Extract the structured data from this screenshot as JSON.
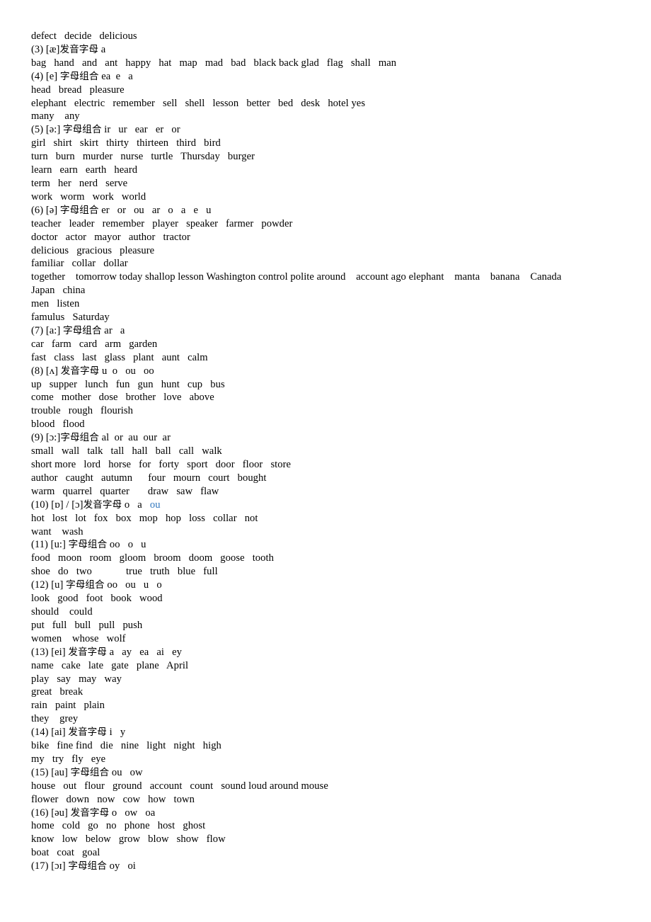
{
  "document": {
    "title": "English Phonetics Word List",
    "text_color": "#000000",
    "accent_color": "#3077BE",
    "background_color": "#ffffff"
  },
  "lines": [
    {
      "id": "l1",
      "type": "words",
      "text": "defect   decide   delicious"
    },
    {
      "id": "l2",
      "type": "heading",
      "number": "(3)",
      "ipa": "[æ]",
      "cjk": "发音字母",
      "letters": "a",
      "text": "(3) [æ]发音字母 a"
    },
    {
      "id": "l3",
      "type": "words",
      "text": "bag   hand   and   ant   happy   hat   map   mad   bad   black back glad   flag   shall   man"
    },
    {
      "id": "l4",
      "type": "heading",
      "number": "(4)",
      "ipa": "[e]",
      "cjk": "字母组合",
      "letters": "ea  e   a",
      "text": "(4) [e] 字母组合 ea  e   a"
    },
    {
      "id": "l5",
      "type": "words",
      "text": "head   bread   pleasure"
    },
    {
      "id": "l6",
      "type": "words",
      "text": "elephant   electric   remember   sell   shell   lesson   better   bed   desk   hotel yes"
    },
    {
      "id": "l7",
      "type": "words",
      "text": "many    any"
    },
    {
      "id": "l8",
      "type": "heading",
      "number": "(5)",
      "ipa": "[ə:]",
      "cjk": "字母组合",
      "letters": "ir   ur   ear   er   or",
      "text": "(5) [ə:] 字母组合 ir   ur   ear   er   or"
    },
    {
      "id": "l9",
      "type": "words",
      "text": "girl   shirt   skirt   thirty   thirteen   third   bird"
    },
    {
      "id": "l10",
      "type": "words",
      "text": "turn   burn   murder   nurse   turtle   Thursday   burger"
    },
    {
      "id": "l11",
      "type": "words",
      "text": "learn   earn   earth   heard"
    },
    {
      "id": "l12",
      "type": "words",
      "text": "term   her   nerd   serve"
    },
    {
      "id": "l13",
      "type": "words",
      "text": "work   worm   work   world"
    },
    {
      "id": "l14",
      "type": "heading",
      "number": "(6)",
      "ipa": "[ə]",
      "cjk": "字母组合",
      "letters": "er   or   ou   ar   o   a   e   u",
      "text": "(6) [ə] 字母组合 er   or   ou   ar   o   a   e   u"
    },
    {
      "id": "l15",
      "type": "words",
      "text": "teacher   leader   remember   player   speaker   farmer   powder"
    },
    {
      "id": "l16",
      "type": "words",
      "text": "doctor   actor   mayor   author   tractor"
    },
    {
      "id": "l17",
      "type": "words",
      "text": "delicious   gracious   pleasure"
    },
    {
      "id": "l18",
      "type": "words",
      "text": "familiar   collar   dollar"
    },
    {
      "id": "l19",
      "type": "words",
      "text": "together    tomorrow today shallop lesson Washington control polite around    account ago elephant    manta    banana    Canada"
    },
    {
      "id": "l20",
      "type": "words",
      "text": "Japan   china"
    },
    {
      "id": "l21",
      "type": "words",
      "text": "men   listen"
    },
    {
      "id": "l22",
      "type": "words",
      "text": "famulus   Saturday"
    },
    {
      "id": "l23",
      "type": "heading",
      "number": "(7)",
      "ipa": "[a:]",
      "cjk": "字母组合",
      "letters": "ar   a",
      "text": "(7) [a:] 字母组合 ar   a"
    },
    {
      "id": "l24",
      "type": "words",
      "text": "car   farm   card   arm   garden"
    },
    {
      "id": "l25",
      "type": "words",
      "text": "fast   class   last   glass   plant   aunt   calm"
    },
    {
      "id": "l26",
      "type": "heading",
      "number": "(8)",
      "ipa": "[ʌ]",
      "cjk": "发音字母",
      "letters": "u  o   ou   oo",
      "text": "(8) [ʌ] 发音字母 u  o   ou   oo"
    },
    {
      "id": "l27",
      "type": "words",
      "text": "up   supper   lunch   fun   gun   hunt   cup   bus"
    },
    {
      "id": "l28",
      "type": "words",
      "text": "come   mother   dose   brother   love   above"
    },
    {
      "id": "l29",
      "type": "words",
      "text": "trouble   rough   flourish"
    },
    {
      "id": "l30",
      "type": "words",
      "text": "blood   flood"
    },
    {
      "id": "l31",
      "type": "heading",
      "number": "(9)",
      "ipa": "[ɔ:]",
      "cjk": "字母组合",
      "letters": "al  or  au  our  ar",
      "text": "(9) [ɔ:]字母组合 al  or  au  our  ar"
    },
    {
      "id": "l32",
      "type": "words",
      "text": "small   wall   talk   tall   hall   ball   call   walk"
    },
    {
      "id": "l33",
      "type": "words",
      "text": "short more   lord   horse   for   forty   sport   door   floor   store"
    },
    {
      "id": "l34",
      "type": "words",
      "text": "author   caught   autumn      four   mourn   court   bought"
    },
    {
      "id": "l35",
      "type": "words",
      "text": "warm   quarrel   quarter       draw   saw   flaw"
    },
    {
      "id": "l36",
      "type": "heading-accent",
      "number": "(10)",
      "ipa": "[ɒ] / [ɔ]",
      "cjk": "发音字母",
      "letters": "o   a",
      "accent_text": "ou",
      "text": "(10) [ɒ] / [ɔ]发音字母 o   a   "
    },
    {
      "id": "l37",
      "type": "words",
      "text": "hot   lost   lot   fox   box   mop   hop   loss   collar   not"
    },
    {
      "id": "l38",
      "type": "words",
      "text": "want    wash"
    },
    {
      "id": "l39",
      "type": "heading",
      "number": "(11)",
      "ipa": "[u:]",
      "cjk": "字母组合",
      "letters": "oo   o   u",
      "text": "(11) [u:] 字母组合 oo   o   u"
    },
    {
      "id": "l40",
      "type": "words",
      "text": "food   moon   room   gloom   broom   doom   goose   tooth"
    },
    {
      "id": "l41",
      "type": "words",
      "text": "shoe   do   two             true   truth   blue   full"
    },
    {
      "id": "l42",
      "type": "heading",
      "number": "(12)",
      "ipa": "[u]",
      "cjk": "字母组合",
      "letters": "oo   ou   u   o",
      "text": "(12) [u] 字母组合 oo   ou   u   o"
    },
    {
      "id": "l43",
      "type": "words",
      "text": "look   good   foot   book   wood"
    },
    {
      "id": "l44",
      "type": "words",
      "text": "should    could"
    },
    {
      "id": "l45",
      "type": "words",
      "text": "put   full   bull   pull   push"
    },
    {
      "id": "l46",
      "type": "words",
      "text": "women    whose   wolf"
    },
    {
      "id": "l47",
      "type": "heading",
      "number": "(13)",
      "ipa": "[ei]",
      "cjk": "发音字母",
      "letters": "a   ay   ea   ai   ey",
      "text": "(13) [ei] 发音字母 a   ay   ea   ai   ey"
    },
    {
      "id": "l48",
      "type": "words",
      "text": "name   cake   late   gate   plane   April"
    },
    {
      "id": "l49",
      "type": "words",
      "text": "play   say   may   way"
    },
    {
      "id": "l50",
      "type": "words",
      "text": "great   break"
    },
    {
      "id": "l51",
      "type": "words",
      "text": "rain   paint   plain"
    },
    {
      "id": "l52",
      "type": "words",
      "text": "they    grey"
    },
    {
      "id": "l53",
      "type": "heading",
      "number": "(14)",
      "ipa": "[ai]",
      "cjk": "发音字母",
      "letters": "i   y",
      "text": "(14) [ai] 发音字母 i   y"
    },
    {
      "id": "l54",
      "type": "words",
      "text": "bike   fine find   die   nine   light   night   high"
    },
    {
      "id": "l55",
      "type": "words",
      "text": "my   try   fly   eye"
    },
    {
      "id": "l56",
      "type": "heading",
      "number": "(15)",
      "ipa": "[au]",
      "cjk": "字母组合",
      "letters": "ou   ow",
      "text": "(15) [au] 字母组合 ou   ow"
    },
    {
      "id": "l57",
      "type": "words",
      "text": "house   out   flour   ground   account   count   sound loud around mouse"
    },
    {
      "id": "l58",
      "type": "words",
      "text": "flower   down   now   cow   how   town"
    },
    {
      "id": "l59",
      "type": "heading",
      "number": "(16)",
      "ipa": "[əu]",
      "cjk": "发音字母",
      "letters": "o   ow   oa",
      "text": "(16) [əu] 发音字母 o   ow   oa"
    },
    {
      "id": "l60",
      "type": "words",
      "text": "home   cold   go   no   phone   host   ghost"
    },
    {
      "id": "l61",
      "type": "words",
      "text": "know   low   below   grow   blow   show   flow"
    },
    {
      "id": "l62",
      "type": "words",
      "text": "boat   coat   goal"
    },
    {
      "id": "l63",
      "type": "heading",
      "number": "(17)",
      "ipa": "[ɔɪ]",
      "cjk": "字母组合",
      "letters": "oy   oi",
      "text": "(17) [ɔɪ] 字母组合 oy   oi"
    }
  ]
}
